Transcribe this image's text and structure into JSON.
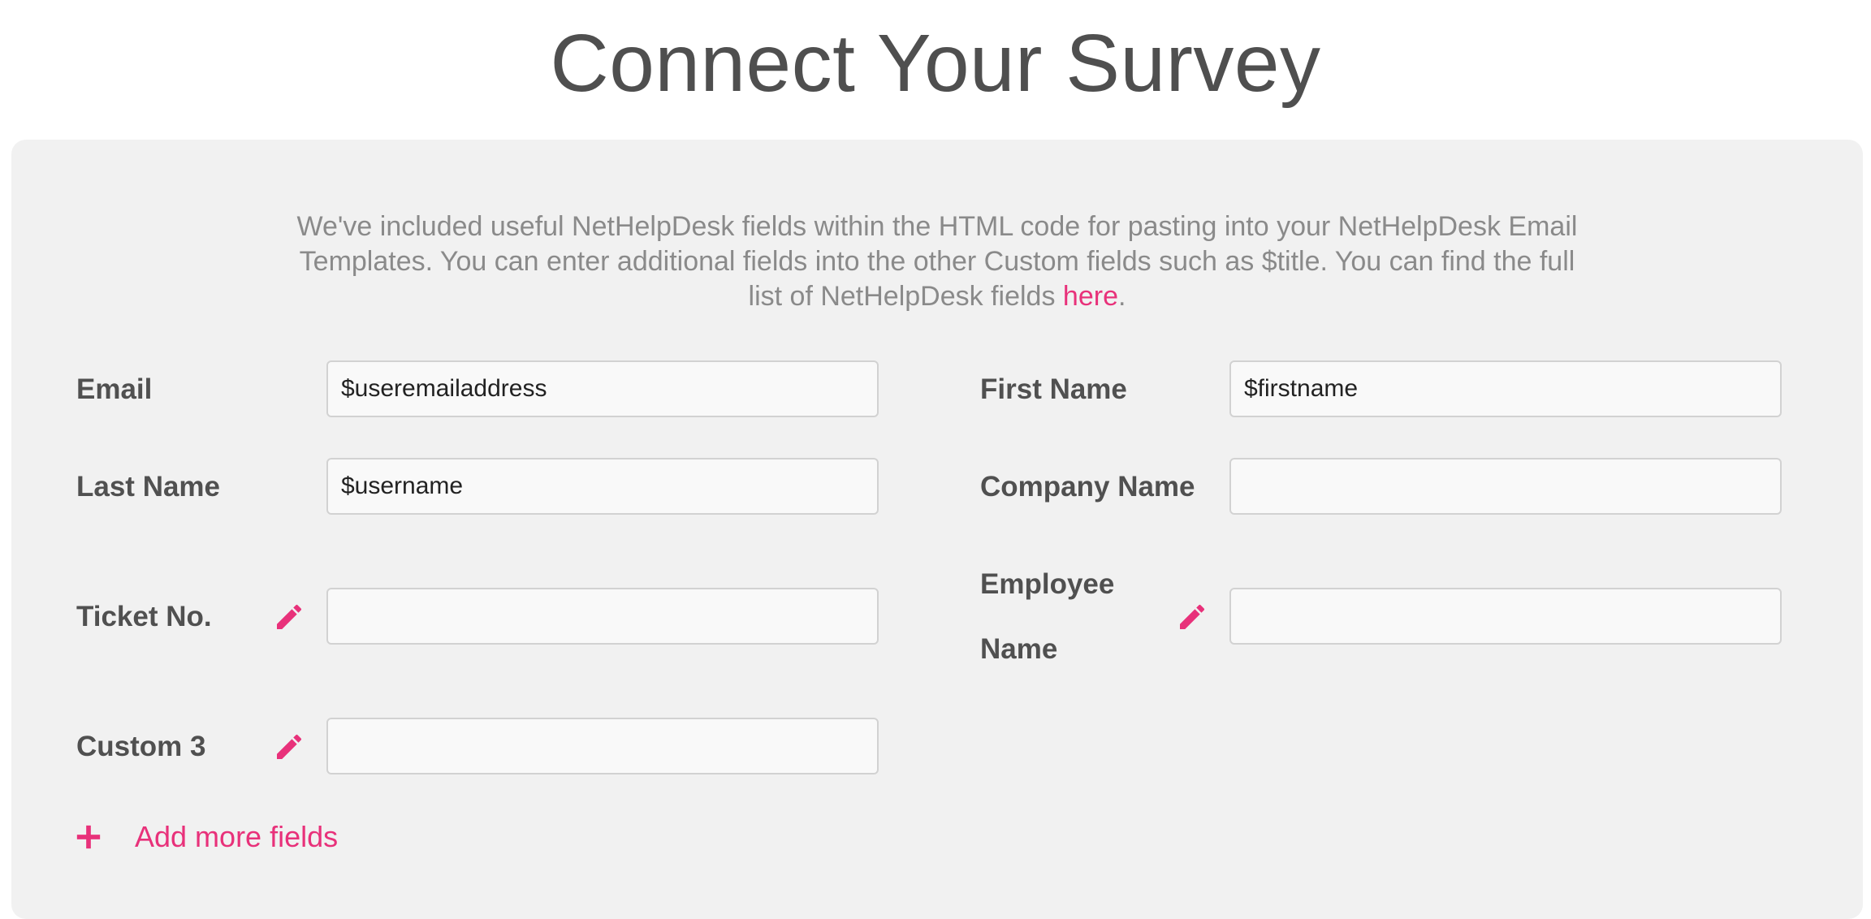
{
  "page": {
    "title": "Connect Your Survey"
  },
  "intro": {
    "text_before_link": "We've included useful NetHelpDesk fields within the HTML code for pasting into your NetHelpDesk Email Templates. You can enter additional fields into the other Custom fields such as $title. You can find the full list of NetHelpDesk fields ",
    "link_text": "here",
    "text_after_link": "."
  },
  "fields": {
    "email": {
      "label": "Email",
      "value": "$useremailaddress"
    },
    "first_name": {
      "label": "First Name",
      "value": "$firstname"
    },
    "last_name": {
      "label": "Last Name",
      "value": "$username"
    },
    "company_name": {
      "label": "Company Name",
      "value": ""
    },
    "ticket_no": {
      "label": "Ticket No.",
      "value": "",
      "icon": "pencil-icon"
    },
    "employee_name": {
      "label_line1": "Employee",
      "label_line2": "Name",
      "value": "",
      "icon": "pencil-icon"
    },
    "custom_3": {
      "label": "Custom 3",
      "value": "",
      "icon": "pencil-icon"
    }
  },
  "add_more": {
    "label": "Add more fields",
    "icon": "plus-icon"
  },
  "colors": {
    "accent": "#e8317a",
    "panel_bg": "#f1f1f1",
    "label_text": "#505050",
    "intro_text": "#8a8a8a"
  }
}
